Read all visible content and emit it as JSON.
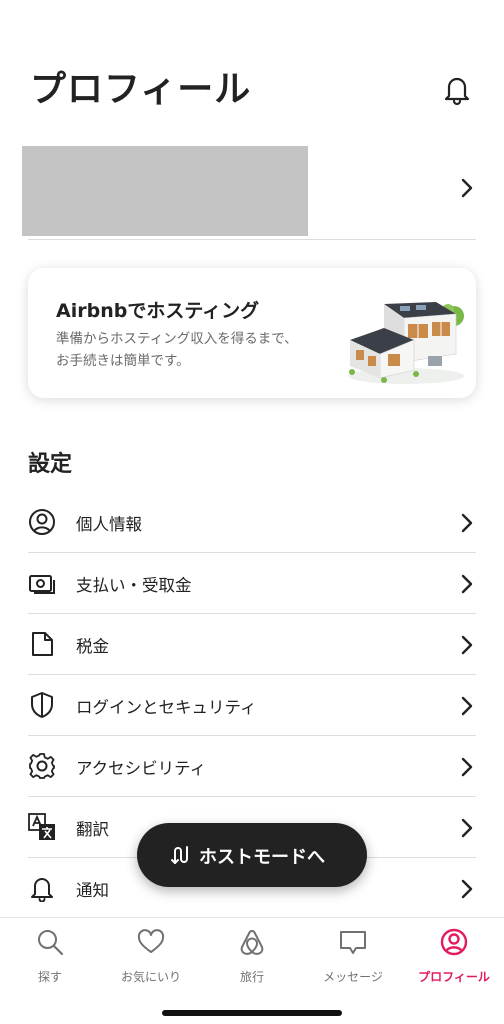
{
  "header": {
    "title": "プロフィール",
    "bell_icon": "bell-icon"
  },
  "host_card": {
    "title": "Airbnbでホスティング",
    "description": "準備からホスティング収入を得るまで、お手続きは簡単です。"
  },
  "settings": {
    "heading": "設定",
    "items": [
      {
        "label": "個人情報",
        "icon": "user-circle-icon"
      },
      {
        "label": "支払い・受取金",
        "icon": "payments-icon"
      },
      {
        "label": "税金",
        "icon": "document-icon"
      },
      {
        "label": "ログインとセキュリティ",
        "icon": "shield-icon"
      },
      {
        "label": "アクセシビリティ",
        "icon": "gear-icon"
      },
      {
        "label": "翻訳",
        "icon": "translate-icon"
      },
      {
        "label": "通知",
        "icon": "bell-icon"
      }
    ]
  },
  "host_mode_button": {
    "label": "ホストモードへ"
  },
  "tabbar": {
    "tabs": [
      {
        "label": "探す",
        "icon": "search-icon"
      },
      {
        "label": "お気にいり",
        "icon": "heart-icon"
      },
      {
        "label": "旅行",
        "icon": "airbnb-logo-icon"
      },
      {
        "label": "メッセージ",
        "icon": "message-icon"
      },
      {
        "label": "プロフィール",
        "icon": "profile-icon"
      }
    ],
    "active_tab": "プロフィール"
  },
  "colors": {
    "accent": "#E31C5F",
    "text": "#222222",
    "muted": "#717171",
    "divider": "#DDDDDD",
    "button_bg": "#222222"
  }
}
